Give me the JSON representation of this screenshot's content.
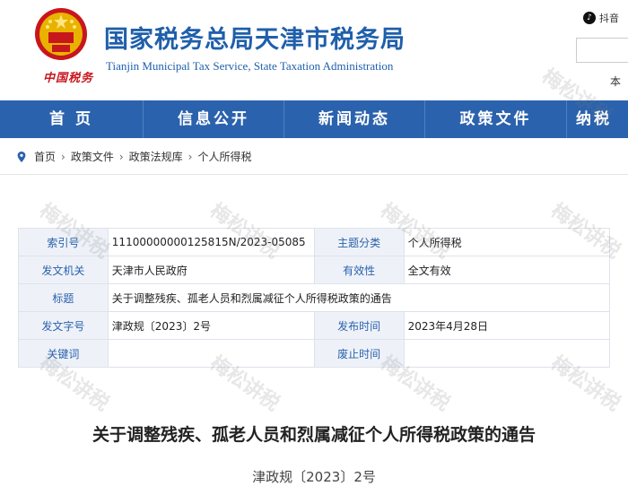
{
  "header": {
    "title": "国家税务总局天津市税务局",
    "subtitle": "Tianjin Municipal Tax Service, State Taxation Administration",
    "brand_text": "中国税务",
    "douyin_label": "抖音",
    "search_partial": "本"
  },
  "nav": {
    "items": [
      {
        "label": "首 页"
      },
      {
        "label": "信息公开"
      },
      {
        "label": "新闻动态"
      },
      {
        "label": "政策文件"
      },
      {
        "label": "纳税"
      }
    ]
  },
  "breadcrumb": [
    "首页",
    "政策文件",
    "政策法规库",
    "个人所得税"
  ],
  "meta": {
    "index_label": "索引号",
    "index_value": "11100000000125815N/2023-05085",
    "topic_label": "主题分类",
    "topic_value": "个人所得税",
    "issuer_label": "发文机关",
    "issuer_value": "天津市人民政府",
    "validity_label": "有效性",
    "validity_value": "全文有效",
    "title_label": "标题",
    "title_value": "关于调整残疾、孤老人员和烈属减征个人所得税政策的通告",
    "docno_label": "发文字号",
    "docno_value": "津政规〔2023〕2号",
    "pubdate_label": "发布时间",
    "pubdate_value": "2023年4月28日",
    "keywords_label": "关键词",
    "keywords_value": "",
    "abolish_label": "废止时间",
    "abolish_value": ""
  },
  "article": {
    "title": "关于调整残疾、孤老人员和烈属减征个人所得税政策的通告",
    "doc_no": "津政规〔2023〕2号"
  },
  "watermark": "梅松讲税",
  "colors": {
    "brand_blue": "#2b62ad",
    "title_blue": "#1f5fab",
    "emblem_red": "#c8161d",
    "label_bg": "#eef2f8"
  }
}
